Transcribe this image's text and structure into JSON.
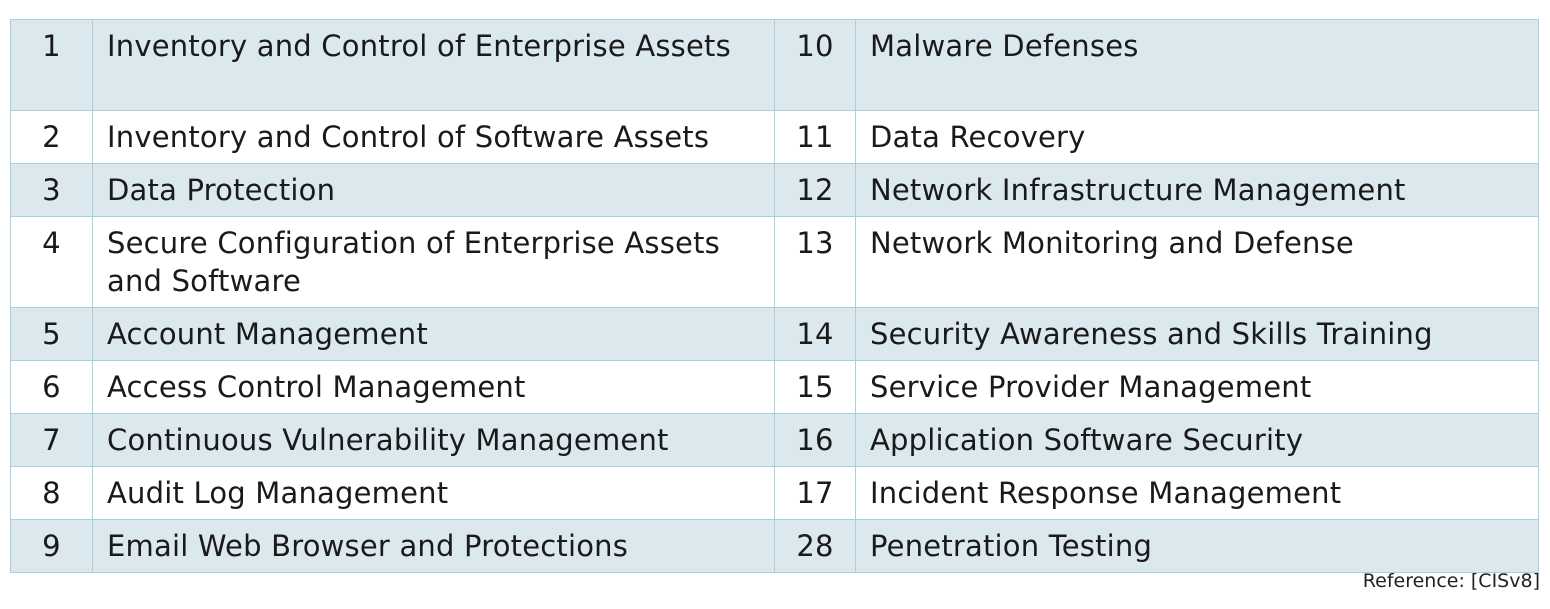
{
  "table": {
    "rows": [
      {
        "left_num": "1",
        "left_name": "Inventory and Control of Enterprise Assets",
        "right_num": "10",
        "right_name": "Malware Defenses"
      },
      {
        "left_num": "2",
        "left_name": "Inventory and Control of Software Assets",
        "right_num": "11",
        "right_name": "Data Recovery"
      },
      {
        "left_num": "3",
        "left_name": "Data Protection",
        "right_num": "12",
        "right_name": "Network Infrastructure Management"
      },
      {
        "left_num": "4",
        "left_name": "Secure Configuration of Enterprise Assets and Software",
        "right_num": "13",
        "right_name": "Network Monitoring and Defense"
      },
      {
        "left_num": "5",
        "left_name": "Account Management",
        "right_num": "14",
        "right_name": "Security Awareness and Skills Training"
      },
      {
        "left_num": "6",
        "left_name": "Access Control Management",
        "right_num": "15",
        "right_name": "Service Provider Management"
      },
      {
        "left_num": "7",
        "left_name": "Continuous Vulnerability Management",
        "right_num": "16",
        "right_name": "Application Software Security"
      },
      {
        "left_num": "8",
        "left_name": "Audit Log Management",
        "right_num": "17",
        "right_name": "Incident Response Management"
      },
      {
        "left_num": "9",
        "left_name": "Email Web Browser and Protections",
        "right_num": "28",
        "right_name": "Penetration Testing"
      }
    ]
  },
  "reference": "Reference:  [CISv8]",
  "colors": {
    "row_shade": "#dbe9ef",
    "row_plain": "#ffffff",
    "border": "#a9cfdc"
  }
}
